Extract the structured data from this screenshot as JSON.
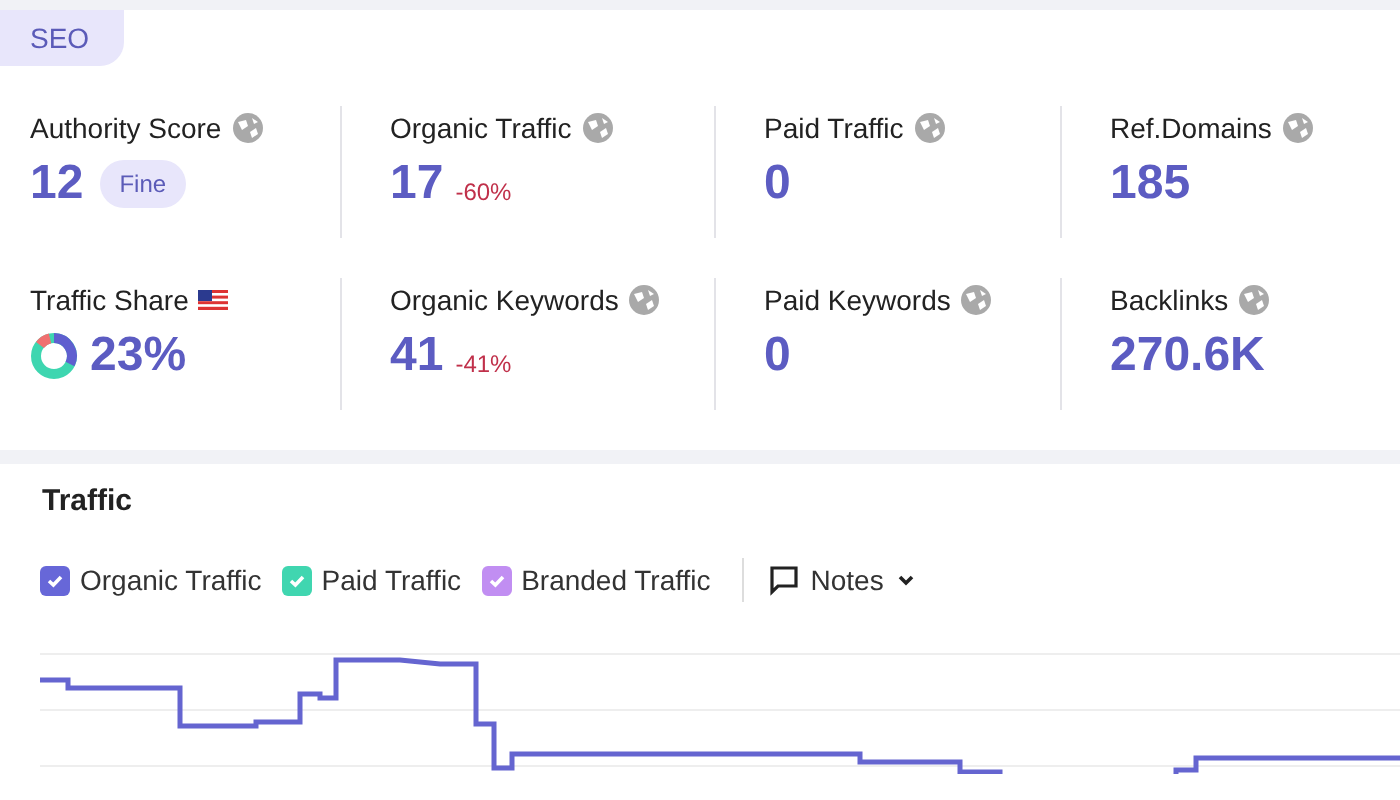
{
  "section_tab": {
    "label": "SEO",
    "selected": true
  },
  "metrics": [
    {
      "kind": "plain",
      "label": "Authority Score",
      "value": "12",
      "badge": "Fine"
    },
    {
      "kind": "plain",
      "label": "Organic Traffic",
      "value": "17",
      "change": "-60%"
    },
    {
      "kind": "plain",
      "label": "Paid Traffic",
      "value": "0"
    },
    {
      "kind": "plain",
      "label": "Ref.Domains",
      "value": "185"
    },
    {
      "kind": "share",
      "label": "Traffic Share",
      "value": "23%"
    },
    {
      "kind": "plain",
      "label": "Organic Keywords",
      "value": "41",
      "change": "-41%"
    },
    {
      "kind": "plain",
      "label": "Paid Keywords",
      "value": "0"
    },
    {
      "kind": "plain",
      "label": "Backlinks",
      "value": "270.6K"
    }
  ],
  "traffic": {
    "title": "Traffic",
    "legend": [
      {
        "label": "Organic Traffic",
        "checked": true,
        "color": "#6767d8"
      },
      {
        "label": "Paid Traffic",
        "checked": true,
        "color": "#40d6b0"
      },
      {
        "label": "Branded Traffic",
        "checked": true,
        "color": "#c18ef2"
      }
    ],
    "notes": "Notes"
  }
}
